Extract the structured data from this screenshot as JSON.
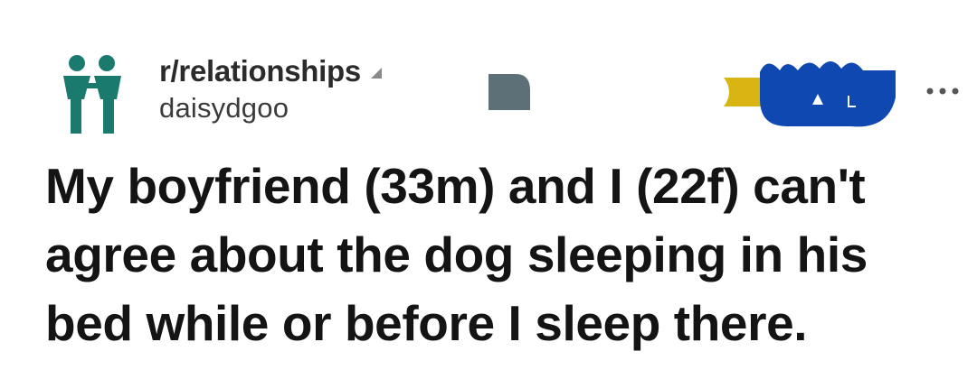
{
  "post": {
    "subreddit": "r/relationships",
    "username": "daisydgoo",
    "title": "My boyfriend (33m) and I (22f) can't agree about the dog sleeping in his bed while or before I sleep there."
  },
  "icons": {
    "community": "couple-icon",
    "caret": "caret-icon",
    "flair": "flair-icon",
    "award": "award-icon",
    "more": "more-options-icon"
  },
  "colors": {
    "community_icon": "#1b7a6e",
    "flair": "#5d7078",
    "award_gold": "#d9b514",
    "award_blue": "#0f48b0",
    "text": "#141414"
  }
}
